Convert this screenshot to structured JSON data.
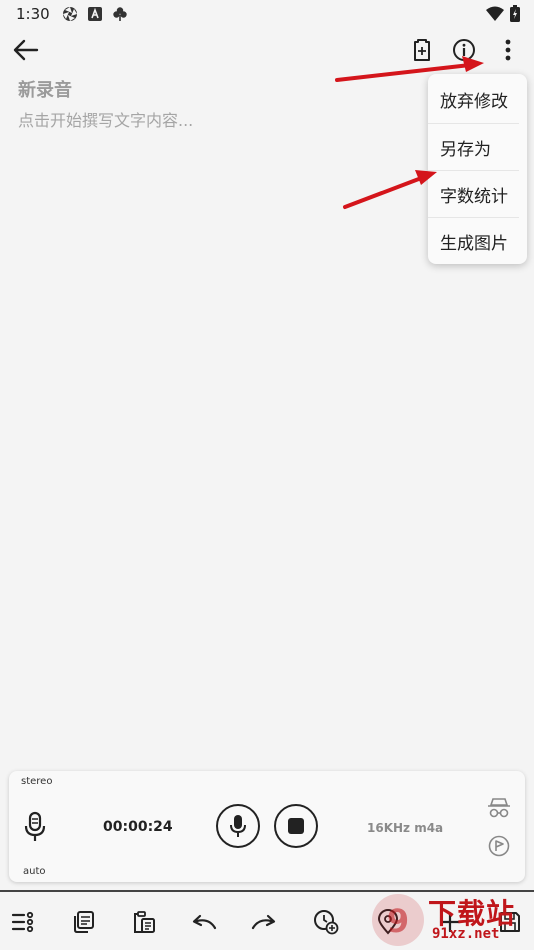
{
  "status_bar": {
    "time": "1:30",
    "icons": [
      "aperture-icon",
      "a-badge-icon",
      "clover-icon"
    ],
    "right_icons": [
      "wifi-icon",
      "battery-icon"
    ]
  },
  "toolbar": {
    "back_icon": "arrow-left-icon",
    "actions": [
      "add-file-icon",
      "info-icon",
      "more-vert-icon"
    ]
  },
  "note": {
    "title": "新录音",
    "placeholder": "点击开始撰写文字内容..."
  },
  "menu": {
    "items": [
      "放弃修改",
      "另存为",
      "字数统计",
      "生成图片"
    ]
  },
  "recorder": {
    "channel": "stereo",
    "timer": "00:00:24",
    "format": "16KHz m4a",
    "mode": "auto"
  },
  "bottom_bar": {
    "icons": [
      "list-menu-icon",
      "copy-icon",
      "paste-icon",
      "undo-icon",
      "redo-icon",
      "add-time-icon",
      "location-icon",
      "add-icon",
      "save-icon"
    ]
  },
  "watermark": {
    "line1": "下载站",
    "line2": "91xz.net"
  },
  "colors": {
    "background": "#f4f4f4",
    "annotation_arrow": "#d4151b",
    "text_dark": "#222222"
  }
}
